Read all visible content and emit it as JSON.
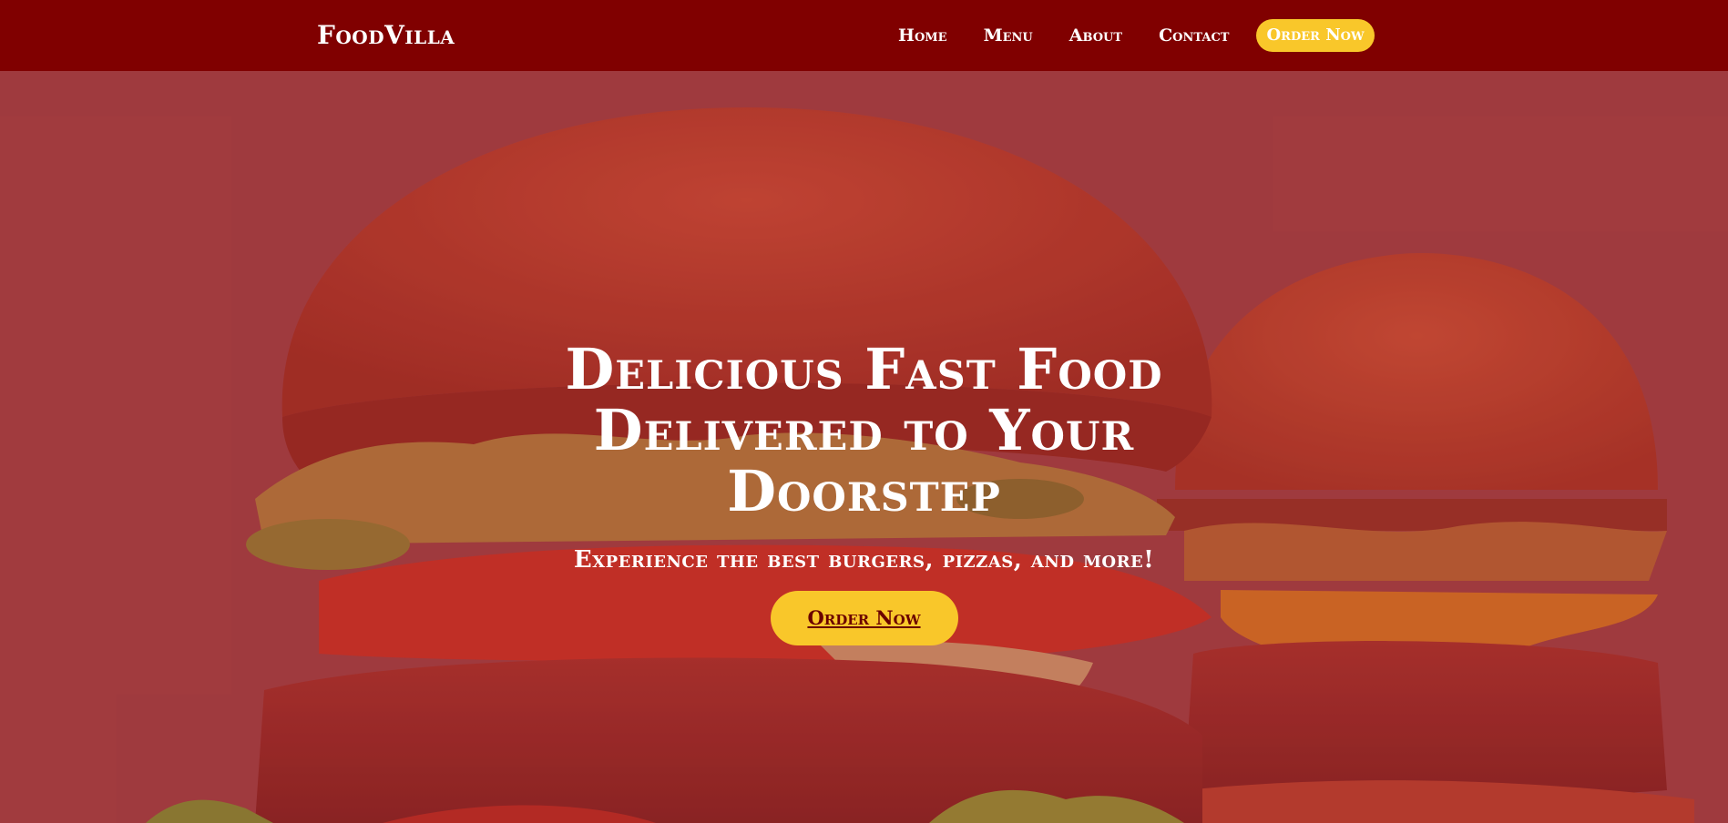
{
  "navbar": {
    "brand": "FoodVilla",
    "links": [
      "Home",
      "Menu",
      "About",
      "Contact"
    ],
    "cta_label": "Order Now"
  },
  "hero": {
    "title": "Delicious Fast Food Delivered to Your Doorstep",
    "subtitle": "Experience the best burgers, pizzas, and more!",
    "cta_label": "Order Now"
  },
  "colors": {
    "navbar_bg": "#800000",
    "accent_yellow": "#f9c72a",
    "hero_tint": "#a84a4c"
  }
}
